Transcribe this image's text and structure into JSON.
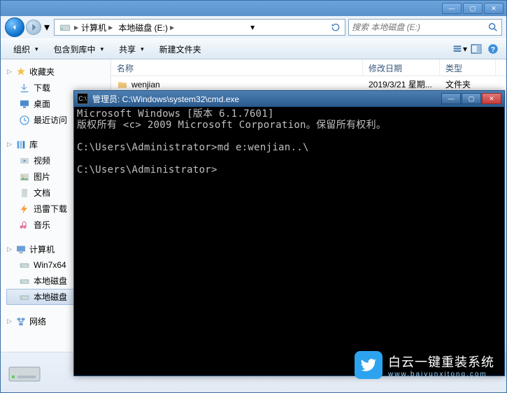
{
  "titlebar": {
    "minimize": "—",
    "maximize": "▢",
    "close": "✕"
  },
  "nav": {
    "breadcrumbs": [
      "计算机",
      "本地磁盘 (E:)"
    ],
    "search_placeholder": "搜索 本地磁盘 (E:)"
  },
  "toolbar": {
    "organize": "组织",
    "include": "包含到库中",
    "share": "共享",
    "newfolder": "新建文件夹"
  },
  "sidebar": {
    "favorites": {
      "label": "收藏夹",
      "items": [
        "下载",
        "桌面",
        "最近访问"
      ]
    },
    "libraries": {
      "label": "库",
      "items": [
        "视频",
        "图片",
        "文档",
        "迅雷下载",
        "音乐"
      ]
    },
    "computer": {
      "label": "计算机",
      "items": [
        "Win7x64",
        "本地磁盘",
        "本地磁盘"
      ],
      "selected_index": 2
    },
    "network": {
      "label": "网络"
    }
  },
  "filelist": {
    "columns": {
      "name": "名称",
      "date": "修改日期",
      "type": "类型"
    },
    "col_widths": {
      "name": 360,
      "date": 110,
      "type": 80
    },
    "rows": [
      {
        "name": "wenjian",
        "date": "2019/3/21 星期...",
        "type": "文件夹"
      }
    ]
  },
  "cmd": {
    "title": "管理员: C:\\Windows\\system32\\cmd.exe",
    "lines": [
      "Microsoft Windows [版本 6.1.7601]",
      "版权所有 <c> 2009 Microsoft Corporation。保留所有权利。",
      "",
      "C:\\Users\\Administrator>md e:wenjian..\\",
      "",
      "C:\\Users\\Administrator>"
    ]
  },
  "watermark": {
    "text": "白云一键重装系统",
    "sub": "www.baiyunxitong.com"
  }
}
